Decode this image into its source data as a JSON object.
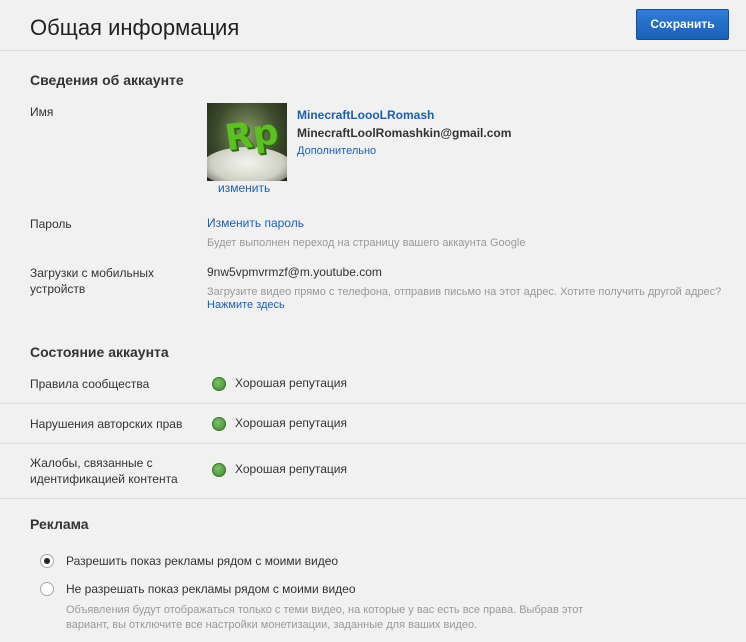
{
  "page": {
    "title": "Общая информация",
    "save_label": "Сохранить"
  },
  "account": {
    "heading": "Сведения об аккаунте",
    "name_label": "Имя",
    "username": "MinecraftLoooLRomash",
    "email": "MinecraftLoolRomashkin@gmail.com",
    "more_link": "Дополнительно",
    "avatar_change": "изменить",
    "password_label": "Пароль",
    "password_link": "Изменить пароль",
    "password_hint": "Будет выполнен переход на страницу вашего аккаунта Google",
    "mobile_label": "Загрузки с мобильных устройств",
    "mobile_email": "9nw5vpmvrmzf@m.youtube.com",
    "mobile_hint": "Загрузите видео прямо с телефона, отправив письмо на этот адрес. Хотите получить другой адрес?",
    "mobile_link": "Нажмите здесь"
  },
  "status": {
    "heading": "Состояние аккаунта",
    "rows": [
      {
        "label": "Правила сообщества",
        "value": "Хорошая репутация"
      },
      {
        "label": "Нарушения авторских прав",
        "value": "Хорошая репутация"
      },
      {
        "label": "Жалобы, связанные с идентификацией контента",
        "value": "Хорошая репутация"
      }
    ]
  },
  "ads": {
    "heading": "Реклама",
    "option_allow": "Разрешить показ рекламы рядом с моими видео",
    "option_deny": "Не разрешать показ рекламы рядом с моими видео",
    "deny_hint": "Объявления будут отображаться только с теми видео, на которые у вас есть все права. Выбрав этот вариант, вы отключите все настройки монетизации, заданные для ваших видео.",
    "selected": "allow"
  }
}
